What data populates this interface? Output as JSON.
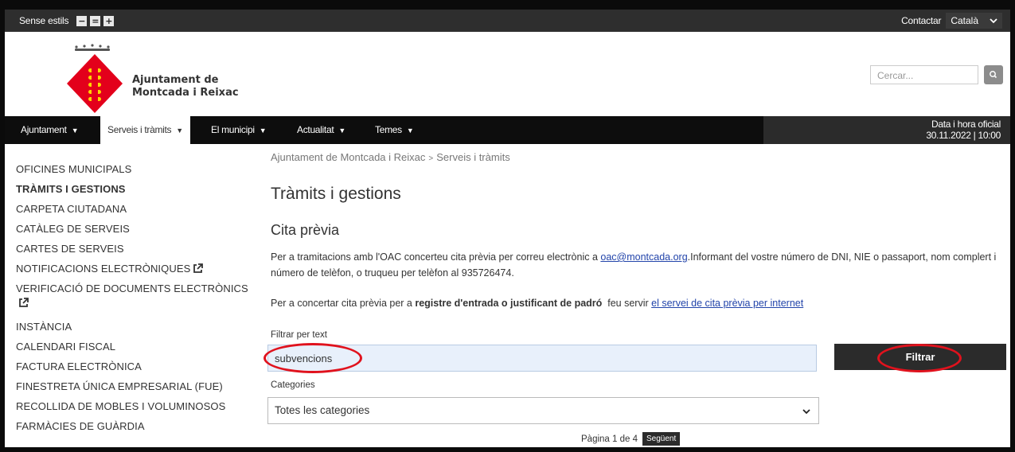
{
  "topbar": {
    "style_label": "Sense estils",
    "text_size_buttons": [
      "−",
      "=",
      "+"
    ],
    "contact_label": "Contactar",
    "language": "Català"
  },
  "header": {
    "brand_line1": "Ajuntament de",
    "brand_line2": "Montcada i Reixac",
    "search_placeholder": "Cercar..."
  },
  "nav": {
    "items": [
      {
        "label": "Ajuntament"
      },
      {
        "label": "Serveis i tràmits"
      },
      {
        "label": "El municipi"
      },
      {
        "label": "Actualitat"
      },
      {
        "label": "Temes"
      }
    ],
    "clock_title": "Data i hora oficial",
    "clock_value": "30.11.2022 | 10:00"
  },
  "sidebar": {
    "items": [
      {
        "label": "OFICINES MUNICIPALS"
      },
      {
        "label": "TRÀMITS I GESTIONS"
      },
      {
        "label": "CARPETA CIUTADANA"
      },
      {
        "label": "CATÀLEG DE SERVEIS"
      },
      {
        "label": "CARTES DE SERVEIS"
      },
      {
        "label": "NOTIFICACIONS ELECTRÒNIQUES"
      },
      {
        "label": "VERIFICACIÓ DE DOCUMENTS ELECTRÒNICS"
      },
      {
        "label": "INSTÀNCIA"
      },
      {
        "label": "CALENDARI FISCAL"
      },
      {
        "label": "FACTURA ELECTRÒNICA"
      },
      {
        "label": "FINESTRETA ÚNICA EMPRESARIAL (FUE)"
      },
      {
        "label": "RECOLLIDA DE MOBLES I VOLUMINOSOS"
      },
      {
        "label": "FARMÀCIES DE GUÀRDIA"
      }
    ]
  },
  "main": {
    "breadcrumb": [
      "Ajuntament de Montcada i Reixac",
      "Serveis i tràmits"
    ],
    "title": "Tràmits i gestions",
    "subtitle": "Cita prèvia",
    "p1_before": "Per a tramitacions amb l'OAC concerteu cita prèvia per correu electrònic a ",
    "p1_link": "oac@montcada.org",
    "p1_after": ".Informant del vostre número de DNI, NIE o passaport, nom complert i número de telèfon, o truqueu per telèfon al 935726474.",
    "p2_before": "Per a concertar cita prèvia per a ",
    "p2_bold": "registre d'entrada o justificant de padró",
    "p2_mid": "  feu servir ",
    "p2_link": "el servei de cita prèvia per internet",
    "filter_label": "Filtrar per text",
    "filter_value": "subvencions",
    "filter_button": "Filtrar",
    "categories_label": "Categories",
    "categories_value": "Totes les categories",
    "pager_text": "Pàgina 1 de 4",
    "pager_next": "Següent"
  },
  "colors": {
    "highlight_ring": "#e0121d",
    "logo_red": "#e3001b",
    "logo_yellow": "#ffd400"
  }
}
